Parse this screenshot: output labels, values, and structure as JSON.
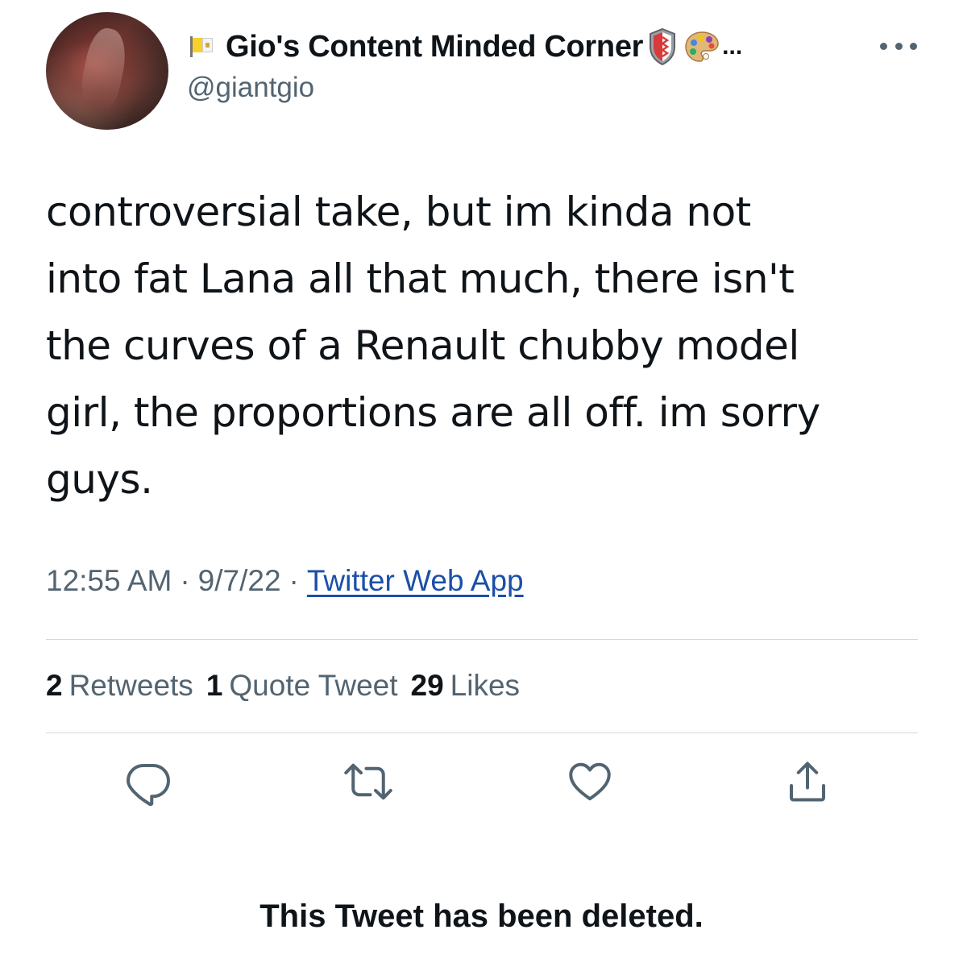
{
  "author": {
    "display_name": "Gio's Content Minded Corner",
    "ellipsis": "...",
    "handle": "@giantgio",
    "name_icons": [
      "vatican-flag-icon",
      "shield-icon",
      "palette-icon"
    ]
  },
  "tweet": {
    "text": "controversial take, but im kinda not\ninto fat Lana all that much, there isn't\nthe curves of a Renault chubby model\ngirl, the proportions are all off. im sorry\nguys.",
    "time": "12:55 AM",
    "date": "9/7/22",
    "separator": "·",
    "source": "Twitter Web App"
  },
  "stats": {
    "retweets_count": "2",
    "retweets_label": "Retweets",
    "quotes_count": "1",
    "quotes_label": "Quote Tweet",
    "likes_count": "29",
    "likes_label": "Likes"
  },
  "actions": [
    "reply-icon",
    "retweet-icon",
    "like-icon",
    "share-icon"
  ],
  "footer": {
    "deleted_notice": "This Tweet has been deleted."
  },
  "colors": {
    "text_primary": "#0f1419",
    "text_secondary": "#536471",
    "link": "#1b4fa8",
    "divider": "#cfd9de"
  }
}
